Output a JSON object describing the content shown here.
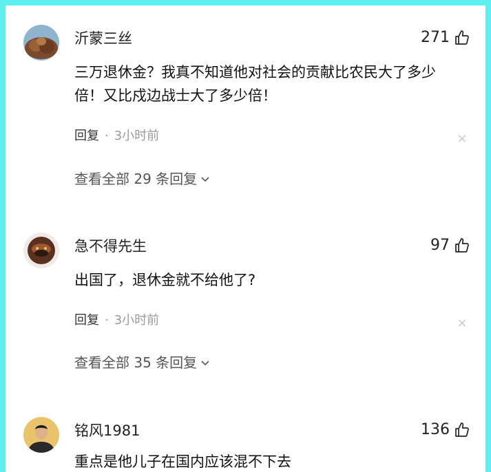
{
  "comments": [
    {
      "username": "沂蒙三丝",
      "likes": "271",
      "text": "三万退休金？我真不知道他对社会的贡献比农民大了多少倍！又比戍边战士大了多少倍！",
      "reply_label": "回复",
      "separator": "·",
      "time": "3小时前",
      "close_icon": "close-icon",
      "view_all": "查看全部 29 条回复"
    },
    {
      "username": "急不得先生",
      "likes": "97",
      "text": "出国了，退休金就不给他了?",
      "reply_label": "回复",
      "separator": "·",
      "time": "3小时前",
      "close_icon": "close-icon",
      "view_all": "查看全部 35 条回复"
    },
    {
      "username": "铭风1981",
      "likes": "136",
      "text": "重点是他儿子在国内应该混不下去"
    }
  ],
  "colors": {
    "frame": "#5ff0f0",
    "text": "#111111",
    "muted": "#9a9a9a"
  }
}
